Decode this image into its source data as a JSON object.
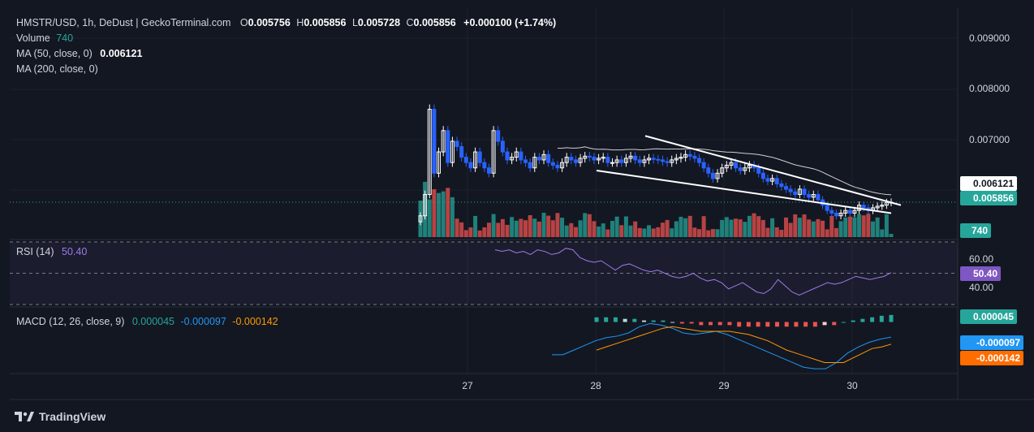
{
  "header": {
    "symbol": "HMSTR/USD, 1h, DeDust | GeckoTerminal.com",
    "o_label": "O",
    "o_value": "0.005756",
    "h_label": "H",
    "h_value": "0.005856",
    "l_label": "L",
    "l_value": "0.005728",
    "c_label": "C",
    "c_value": "0.005856",
    "change": "+0.000100 (+1.74%)"
  },
  "volume_legend": {
    "label": "Volume",
    "value": "740"
  },
  "ma50_legend": {
    "label": "MA (50, close, 0)",
    "value": "0.006121"
  },
  "ma200_legend": {
    "label": "MA (200, close, 0)"
  },
  "rsi_legend": {
    "label": "RSI (14)",
    "value": "50.40"
  },
  "macd_legend": {
    "label": "MACD (12, 26, close, 9)",
    "hist": "0.000045",
    "macd": "-0.000097",
    "signal": "-0.000142"
  },
  "price_axis": {
    "ticks": [
      "0.009000",
      "0.008000",
      "0.007000"
    ],
    "ma_tag": "0.006121",
    "price_tag": "0.005856",
    "volume_tag": "740"
  },
  "rsi_axis": {
    "ticks": [
      "60.00",
      "40.00"
    ],
    "value_tag": "50.40"
  },
  "macd_axis": {
    "hist_tag": "0.000045",
    "macd_tag": "-0.000097",
    "signal_tag": "-0.000142"
  },
  "time_axis": {
    "labels": [
      "27",
      "28",
      "29",
      "30"
    ]
  },
  "footer": {
    "brand": "TradingView"
  },
  "colors": {
    "background": "#131722",
    "up": "#ffffff",
    "down": "#2962ff",
    "vol_up": "#26a69a",
    "vol_down": "#ef5350",
    "rsi": "#9c7ce8",
    "macd": "#2196f3",
    "signal": "#ff9800",
    "hist_up": "#26a69a",
    "hist_down": "#ef5350"
  },
  "chart_data": [
    {
      "type": "candlestick",
      "title": "HMSTR/USD, 1h, DeDust | GeckoTerminal.com",
      "x_labels": [
        "27",
        "28",
        "29",
        "30"
      ],
      "ylim": [
        0.0052,
        0.0095
      ],
      "ohlc_last": {
        "open": 0.005756,
        "high": 0.005856,
        "low": 0.005728,
        "close": 0.005856
      },
      "close": [
        0.0056,
        0.006,
        0.0076,
        0.0064,
        0.0068,
        0.0072,
        0.0066,
        0.007,
        0.0069,
        0.0067,
        0.0066,
        0.0065,
        0.0068,
        0.0066,
        0.0065,
        0.0064,
        0.0072,
        0.007,
        0.0068,
        0.00665,
        0.0067,
        0.0068,
        0.00665,
        0.0066,
        0.0065,
        0.0067,
        0.00665,
        0.00675,
        0.0066,
        0.00655,
        0.0065,
        0.0066,
        0.0067,
        0.00665,
        0.0066,
        0.00668,
        0.00672,
        0.0067,
        0.00665,
        0.00668,
        0.0067,
        0.0066,
        0.0066,
        0.00665,
        0.0066,
        0.00668,
        0.00672,
        0.00665,
        0.0066,
        0.00665,
        0.00668,
        0.00666,
        0.00665,
        0.00662,
        0.0066,
        0.00665,
        0.00668,
        0.0067,
        0.00675,
        0.00672,
        0.00668,
        0.0066,
        0.0065,
        0.0064,
        0.0063,
        0.0064,
        0.0065,
        0.00655,
        0.0066,
        0.0065,
        0.00645,
        0.0065,
        0.00655,
        0.0065,
        0.0064,
        0.0063,
        0.00625,
        0.0063,
        0.0062,
        0.00615,
        0.0061,
        0.00605,
        0.006,
        0.0061,
        0.006,
        0.00595,
        0.006,
        0.0059,
        0.0058,
        0.0057,
        0.00565,
        0.0056,
        0.00565,
        0.0057,
        0.00565,
        0.0057,
        0.0058,
        0.00575,
        0.0057,
        0.00575,
        0.00578,
        0.0058,
        0.00585,
        0.005856
      ],
      "ma50_last": 0.006121,
      "volume_last": 740,
      "channel_upper": [
        [
          0.0071,
          0.0058
        ]
      ],
      "channel_lower": [
        [
          0.00645,
          0.00565
        ]
      ]
    },
    {
      "type": "line",
      "title": "RSI (14)",
      "ylim": [
        30,
        70
      ],
      "bands": [
        70,
        60,
        50,
        40,
        30
      ],
      "values": [
        65,
        64,
        65,
        63,
        64,
        62,
        65,
        64,
        62,
        63,
        66,
        65,
        60,
        58,
        57,
        58,
        55,
        52,
        55,
        56,
        54,
        52,
        51,
        52,
        50,
        48,
        47,
        48,
        50,
        47,
        45,
        46,
        44,
        40,
        42,
        44,
        41,
        38,
        37,
        40,
        46,
        42,
        38,
        36,
        38,
        40,
        42,
        44,
        43,
        44,
        46,
        48,
        47,
        46,
        47,
        48,
        50.4
      ],
      "last": 50.4
    },
    {
      "type": "line",
      "title": "MACD (12, 26, close, 9)",
      "series": [
        {
          "name": "MACD",
          "values": [
            -0.00021,
            -0.00021,
            -0.00018,
            -0.00015,
            -0.00012,
            -0.0001,
            -9e-05,
            -7e-05,
            -3e-05,
            -1e-05,
            -2e-05,
            -4e-05,
            -7e-05,
            -8e-05,
            -7e-05,
            -6e-05,
            -8e-05,
            -0.00011,
            -0.00014,
            -0.00017,
            -0.0002,
            -0.00023,
            -0.00026,
            -0.00029,
            -0.0003,
            -0.0003,
            -0.00026,
            -0.0002,
            -0.00016,
            -0.00013,
            -0.00011,
            -9.7e-05
          ]
        },
        {
          "name": "Signal",
          "values": [
            -0.00018,
            -0.00016,
            -0.00014,
            -0.00012,
            -0.0001,
            -8e-05,
            -6e-05,
            -4e-05,
            -3e-05,
            -4e-05,
            -5e-05,
            -6e-05,
            -6e-05,
            -6e-05,
            -6e-05,
            -7e-05,
            -8e-05,
            -0.0001,
            -0.00012,
            -0.00015,
            -0.00018,
            -0.0002,
            -0.00022,
            -0.00024,
            -0.00026,
            -0.00026,
            -0.00026,
            -0.00023,
            -0.0002,
            -0.00017,
            -0.00016,
            -0.000142
          ]
        }
      ],
      "histogram": [
        3e-05,
        3e-05,
        3e-05,
        2e-05,
        2e-05,
        1e-05,
        1e-05,
        1e-05,
        0.0,
        -1e-05,
        -1e-05,
        -2e-05,
        -2e-05,
        -2e-05,
        -2e-05,
        -3e-05,
        -3e-05,
        -3e-05,
        -3e-05,
        -3e-05,
        -3e-05,
        -3e-05,
        -3e-05,
        -3e-05,
        -2e-05,
        -2e-05,
        0.0,
        1e-05,
        2e-05,
        3e-05,
        4e-05,
        4.5e-05
      ]
    }
  ]
}
